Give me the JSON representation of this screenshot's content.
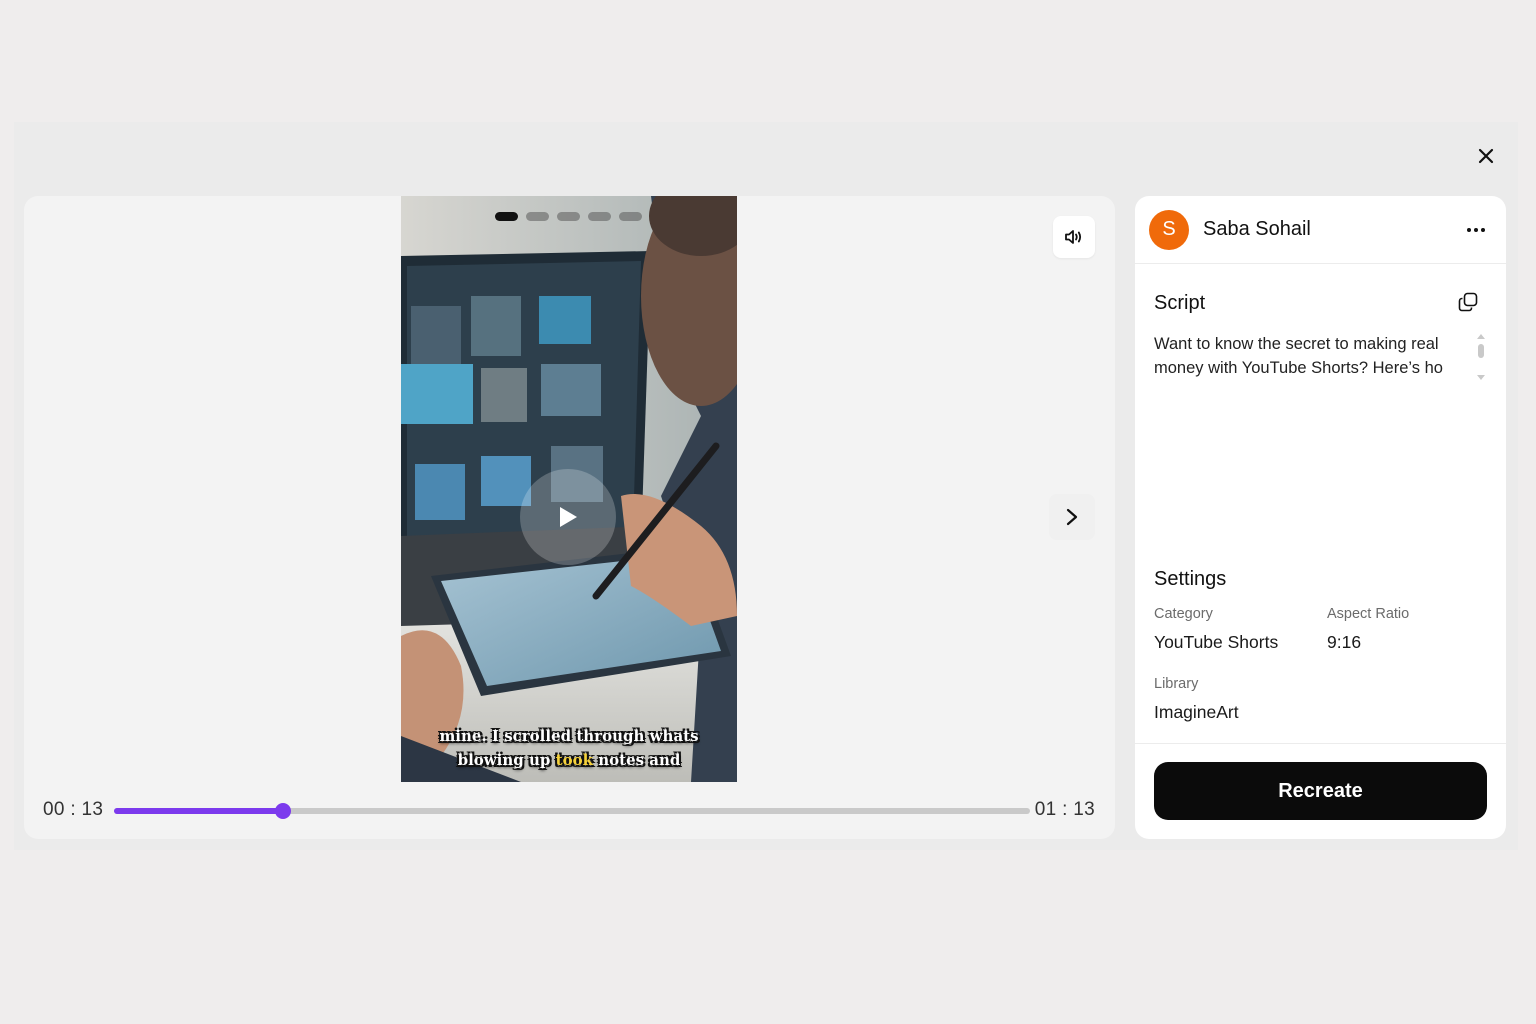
{
  "player": {
    "current_time": "00 : 13",
    "duration": "01 : 13",
    "progress_fraction": 0.184,
    "slide_count": 5,
    "active_slide": 0,
    "caption": {
      "line1": [
        "mine.",
        "I",
        "scrolled",
        "through",
        "whats"
      ],
      "line2": [
        "blowing",
        "up",
        "took",
        "notes",
        "and"
      ],
      "highlight_word": "took"
    },
    "icons": {
      "volume": "volume-icon",
      "play": "play-icon",
      "next": "chevron-right-icon",
      "close": "close-icon"
    }
  },
  "sidebar": {
    "user": {
      "initial": "S",
      "name": "Saba Sohail"
    },
    "script": {
      "title": "Script",
      "line1": "Want to know the secret to making real",
      "line2": "money with YouTube Shorts? Here’s ho"
    },
    "settings": {
      "title": "Settings",
      "category_label": "Category",
      "category_value": "YouTube Shorts",
      "aspect_label": "Aspect Ratio",
      "aspect_value": "9:16",
      "library_label": "Library",
      "library_value": "ImagineArt"
    },
    "action_label": "Recreate"
  },
  "colors": {
    "accent": "#7c3aed",
    "avatar": "#f06a0a",
    "button": "#0b0b0b",
    "caption_highlight": "#f6d23b"
  }
}
